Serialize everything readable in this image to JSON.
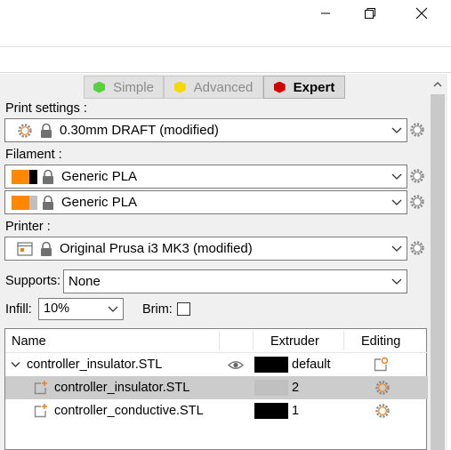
{
  "modes": [
    {
      "label": "Simple",
      "color": "#57d13d",
      "active": false
    },
    {
      "label": "Advanced",
      "color": "#f5d800",
      "active": false
    },
    {
      "label": "Expert",
      "color": "#d40000",
      "active": true
    }
  ],
  "print_settings": {
    "label": "Print settings :",
    "value": "0.30mm DRAFT (modified)"
  },
  "filament": {
    "label": "Filament :",
    "items": [
      {
        "value": "Generic PLA",
        "swatch": "#ff8800",
        "marker": "#000000"
      },
      {
        "value": "Generic PLA",
        "swatch": "#ff8800",
        "marker": "#c0c0c0"
      }
    ]
  },
  "printer": {
    "label": "Printer :",
    "value": "Original Prusa i3 MK3 (modified)"
  },
  "supports": {
    "label": "Supports:",
    "value": "None"
  },
  "infill": {
    "label": "Infill:",
    "value": "10%"
  },
  "brim": {
    "label": "Brim:",
    "checked": false
  },
  "object_list": {
    "headers": {
      "name": "Name",
      "extruder": "Extruder",
      "editing": "Editing"
    },
    "rows": [
      {
        "name": "controller_insulator.STL",
        "extruder": "default",
        "extruder_color": "#000000",
        "selected": false
      },
      {
        "name": "controller_insulator.STL",
        "extruder": "2",
        "extruder_color": "#c0c0c0",
        "selected": true
      },
      {
        "name": "controller_conductive.STL",
        "extruder": "1",
        "extruder_color": "#000000",
        "selected": false
      }
    ]
  },
  "colors": {
    "accent_orange": "#f07e16",
    "panel_bg": "#f0f0f0",
    "selection": "#cccccc"
  }
}
